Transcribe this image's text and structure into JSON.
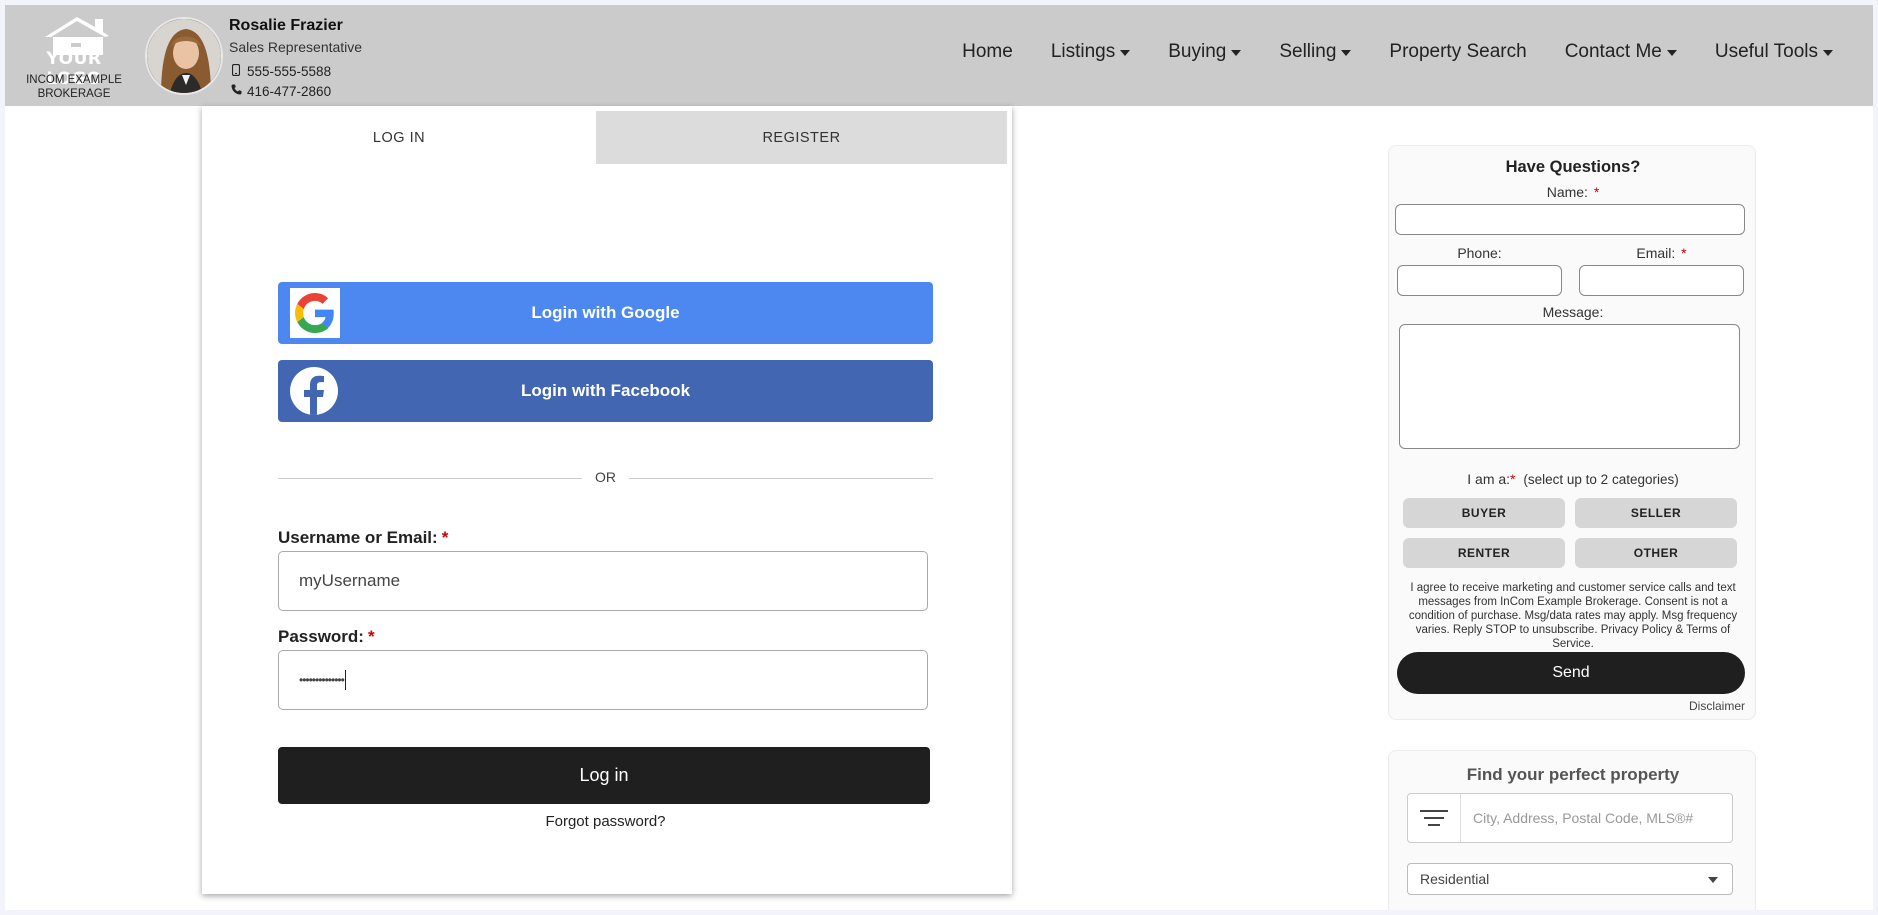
{
  "brand": {
    "logo_text": "YOUR LOGO",
    "brokerage_line1": "INCOM EXAMPLE",
    "brokerage_line2": "BROKERAGE"
  },
  "agent": {
    "name": "Rosalie Frazier",
    "title": "Sales Representative",
    "mobile": "555-555-5588",
    "phone": "416-477-2860"
  },
  "nav": {
    "items": [
      {
        "label": "Home",
        "dropdown": false
      },
      {
        "label": "Listings",
        "dropdown": true
      },
      {
        "label": "Buying",
        "dropdown": true
      },
      {
        "label": "Selling",
        "dropdown": true
      },
      {
        "label": "Property Search",
        "dropdown": false
      },
      {
        "label": "Contact Me",
        "dropdown": true
      },
      {
        "label": "Useful Tools",
        "dropdown": true
      }
    ]
  },
  "login": {
    "tab_login": "LOG IN",
    "tab_register": "REGISTER",
    "google_label": "Login with Google",
    "facebook_label": "Login with Facebook",
    "or_text": "OR",
    "username_label": "Username or Email:",
    "username_value": "myUsername",
    "password_label": "Password:",
    "password_value": "••••••••••••••",
    "required_mark": "*",
    "login_button": "Log in",
    "forgot_link": "Forgot password?"
  },
  "questions": {
    "title": "Have Questions?",
    "name_label": "Name:",
    "phone_label": "Phone:",
    "email_label": "Email:",
    "message_label": "Message:",
    "iam_label": "I am a:",
    "iam_note": "(select up to 2 categories)",
    "categories": [
      "BUYER",
      "SELLER",
      "RENTER",
      "OTHER"
    ],
    "consent_text": "I agree to receive marketing and customer service calls and text messages from InCom Example Brokerage. Consent is not a condition of purchase. Msg/data rates may apply. Msg frequency varies. Reply STOP to unsubscribe. Privacy Policy & Terms of Service.",
    "send_button": "Send",
    "disclaimer": "Disclaimer"
  },
  "property_search": {
    "title": "Find your perfect property",
    "placeholder": "City, Address, Postal Code, MLS®#",
    "type_selected": "Residential"
  },
  "colors": {
    "header_bg": "#cbcbcb",
    "google_blue": "#4c88ef",
    "facebook_blue": "#4266b2",
    "dark_button": "#1f1f1f",
    "required_red": "#cc0000"
  }
}
